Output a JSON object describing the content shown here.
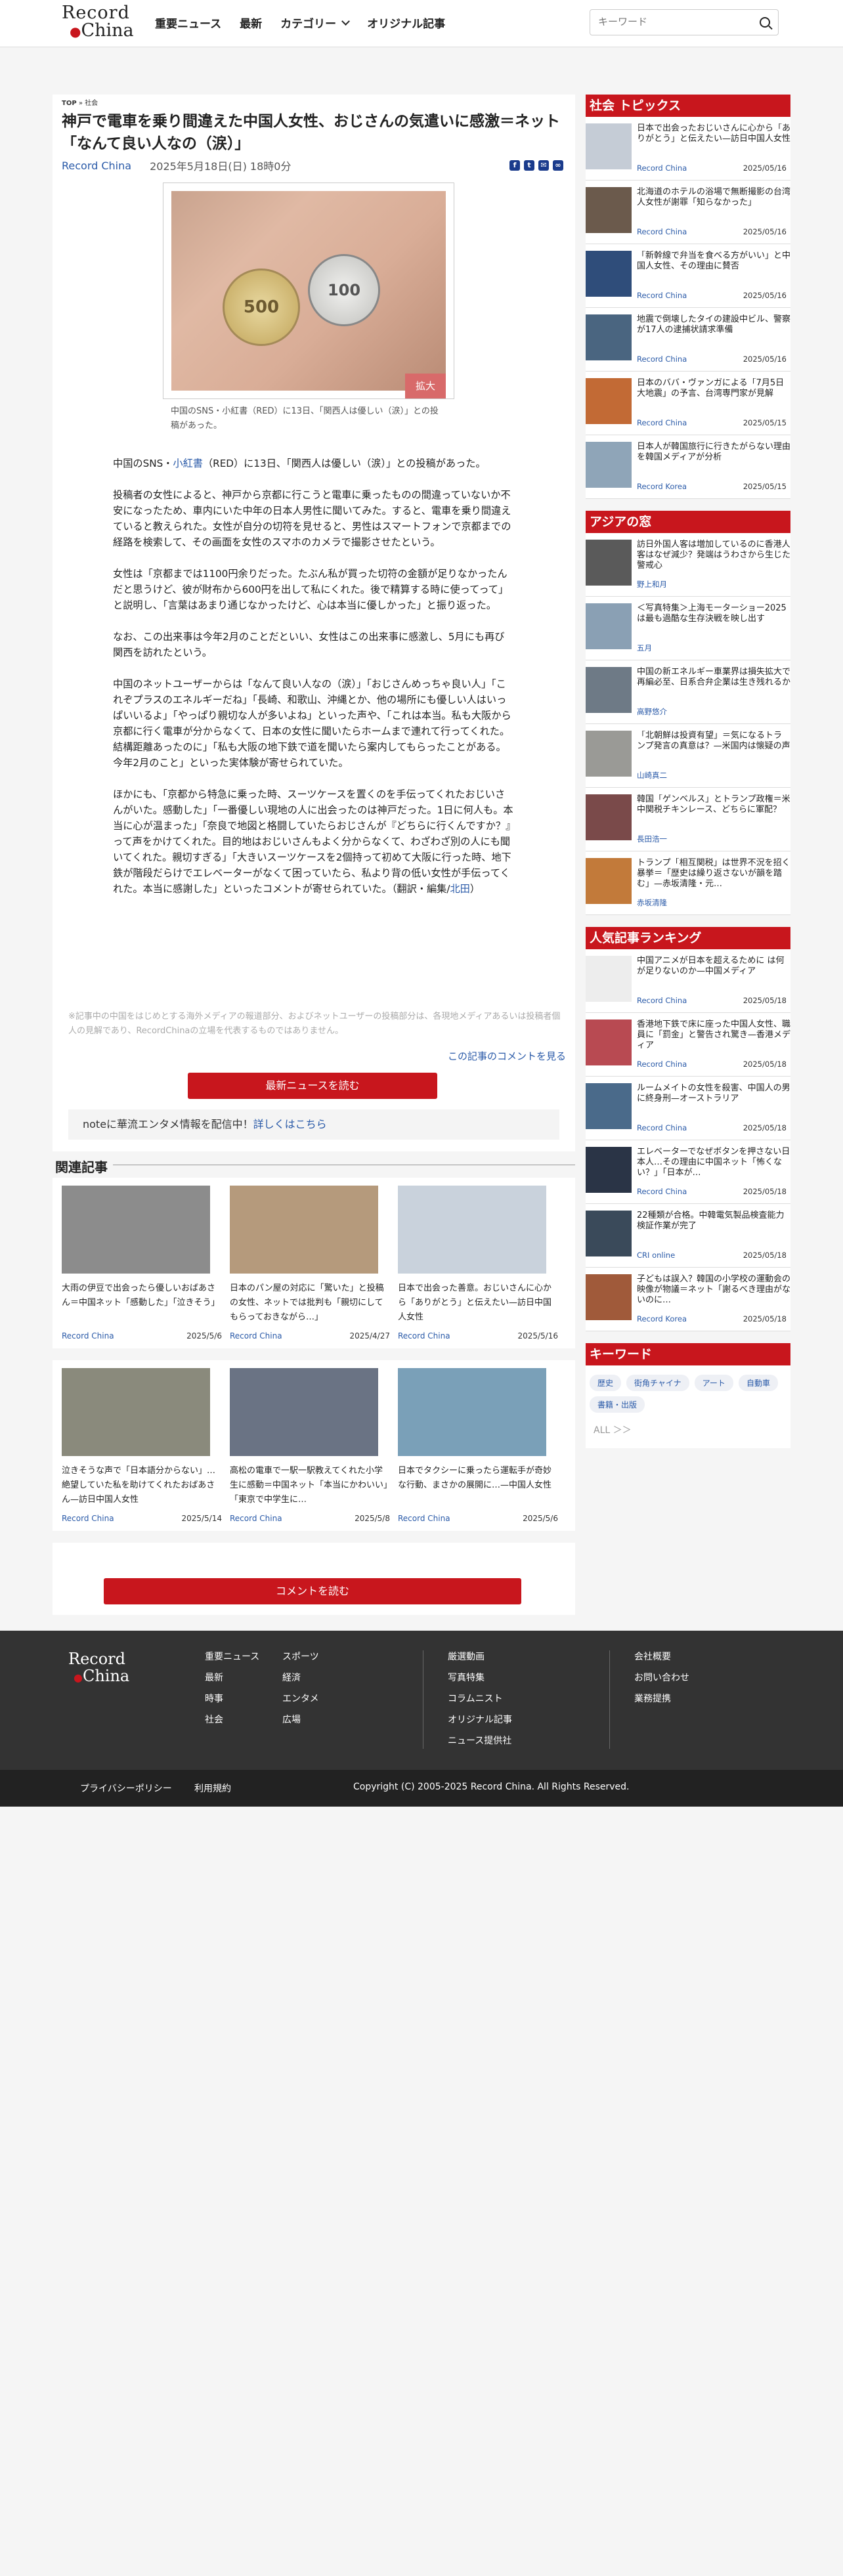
{
  "header": {
    "logo_line1": "Record",
    "logo_line2": "China",
    "nav": [
      "重要ニュース",
      "最新",
      "カテゴリー",
      "オリジナル記事"
    ],
    "search_placeholder": "キーワード"
  },
  "breadcrumb": {
    "top": "TOP",
    "sep": "»",
    "current": "社会"
  },
  "article": {
    "title": "神戸で電車を乗り間違えた中国人女性、おじさんの気遣いに感激＝ネット「なんて良い人なの（涙）」",
    "source": "Record China",
    "date": "2025年5月18日(日) 18時0分",
    "zoom_label": "拡大",
    "coin1": "500",
    "coin2": "100",
    "caption": "中国のSNS・小紅書（RED）に13日、「関西人は優しい（涙）」との投稿があった。",
    "p1_pre": "中国のSNS・",
    "p1_link": "小紅書",
    "p1_post": "（RED）に13日、「関西人は優しい（涙）」との投稿があった。",
    "p2": "投稿者の女性によると、神戸から京都に行こうと電車に乗ったものの間違っていないか不安になったため、車内にいた中年の日本人男性に聞いてみた。すると、電車を乗り間違えていると教えられた。女性が自分の切符を見せると、男性はスマートフォンで京都までの経路を検索して、その画面を女性のスマホのカメラで撮影させたという。",
    "p3": "女性は「京都までは1100円余りだった。たぶん私が買った切符の金額が足りなかったんだと思うけど、彼が財布から600円を出して私にくれた。後で精算する時に使ってって」と説明し、「言葉はあまり通じなかったけど、心は本当に優しかった」と振り返った。",
    "p4": "なお、この出来事は今年2月のことだといい、女性はこの出来事に感激し、5月にも再び関西を訪れたという。",
    "p5": "中国のネットユーザーからは「なんて良い人なの（涙）」「おじさんめっちゃ良い人」「これぞプラスのエネルギーだね」「長崎、和歌山、沖縄とか、他の場所にも優しい人はいっぱいいるよ」「やっぱり親切な人が多いよね」といった声や、「これは本当。私も大阪から京都に行く電車が分からなくて、日本の女性に聞いたらホームまで連れて行ってくれた。結構距離あったのに」「私も大阪の地下鉄で道を聞いたら案内してもらったことがある。今年2月のこと」といった実体験が寄せられていた。",
    "p6_pre": "ほかにも、「京都から特急に乗った時、スーツケースを置くのを手伝ってくれたおじいさんがいた。感動した」「一番優しい現地の人に出会ったのは神戸だった。1日に何人も。本当に心が温まった」「奈良で地図と格闘していたらおじさんが『どちらに行くんですか？』って声をかけてくれた。目的地はおじいさんもよく分からなくて、わざわざ別の人にも聞いてくれた。親切すぎる」「大きいスーツケースを2個持って初めて大阪に行った時、地下鉄が階段だらけでエレベーターがなくて困っていたら、私より背の低い女性が手伝ってくれた。本当に感謝した」といったコメントが寄せられていた。（翻訳・編集/",
    "p6_link": "北田",
    "p6_post": "）"
  },
  "disclaimer": "※記事中の中国をはじめとする海外メディアの報道部分、およびネットユーザーの投稿部分は、各現地メディアあるいは投稿者個人の見解であり、RecordChinaの立場を代表するものではありません。",
  "comments_link": "この記事のコメントを見る",
  "more_news_button": "最新ニュースを読む",
  "note_text": "noteに華流エンタメ情報を配信中！",
  "note_link": "詳しくはこちら",
  "related": {
    "heading": "関連記事",
    "items": [
      {
        "title": "大雨の伊豆で出会ったら優しいおばあさん＝中国ネット「感動した」「泣きそう」",
        "source": "Record China",
        "date": "2025/5/6",
        "color": "#8c8c8c"
      },
      {
        "title": "日本のパン屋の対応に「驚いた」と投稿の女性、ネットでは批判も「親切にしてもらっておきながら…」",
        "source": "Record China",
        "date": "2025/4/27",
        "color": "#b59a7c"
      },
      {
        "title": "日本で出会った善意。おじいさんに心から「ありがとう」と伝えたい—訪日中国人女性",
        "source": "Record China",
        "date": "2025/5/16",
        "color": "#c9d2dc"
      },
      {
        "title": "泣きそうな声で「日本語分からない」…絶望していた私を助けてくれたおばあさん—訪日中国人女性",
        "source": "Record China",
        "date": "2025/5/14",
        "color": "#8a8a7c"
      },
      {
        "title": "高松の電車で一駅一駅教えてくれた小学生に感動＝中国ネット「本当にかわいい」「東京で中学生に…",
        "source": "Record China",
        "date": "2025/5/8",
        "color": "#6a7384"
      },
      {
        "title": "日本でタクシーに乗ったら運転手が奇妙な行動、まさかの展開に…—中国人女性",
        "source": "Record China",
        "date": "2025/5/6",
        "color": "#7aa0b8"
      }
    ]
  },
  "comments_button": "コメントを読む",
  "sidebar": {
    "social_heading": "社会 トピックス",
    "social": [
      {
        "title": "日本で出会ったおじいさんに心から「ありがとう」と伝えたい—訪日中国人女性",
        "source": "Record China",
        "date": "2025/05/16",
        "color": "#c5ccd6"
      },
      {
        "title": "北海道のホテルの浴場で無断撮影の台湾人女性が謝罪「知らなかった」",
        "source": "Record China",
        "date": "2025/05/16",
        "color": "#6b5a4c"
      },
      {
        "title": "「新幹線で弁当を食べる方がいい」と中国人女性、その理由に賛否",
        "source": "Record China",
        "date": "2025/05/16",
        "color": "#2f4d7a"
      },
      {
        "title": "地震で倒壊したタイの建設中ビル、警察が17人の逮捕状請求準備",
        "source": "Record China",
        "date": "2025/05/16",
        "color": "#4a6580"
      },
      {
        "title": "日本のババ・ヴァンガによる「7月5日大地震」の予言、台湾専門家が見解",
        "source": "Record China",
        "date": "2025/05/15",
        "color": "#c26a35"
      },
      {
        "title": "日本人が韓国旅行に行きたがらない理由を韓国メディアが分析",
        "source": "Record Korea",
        "date": "2025/05/15",
        "color": "#8fa5b8"
      }
    ],
    "asia_heading": "アジアの窓",
    "asia": [
      {
        "title": "訪日外国人客は増加しているのに香港人客はなぜ減少？発端はうわさから生じた警戒心",
        "source": "野上和月",
        "color": "#5a5a5a"
      },
      {
        "title": "＜写真特集＞上海モーターショー2025は最も過酷な生存決戦を映し出す",
        "source": "五月",
        "color": "#8aa0b4"
      },
      {
        "title": "中国の新エネルギー車業界は損失拡大で再編必至、日系合弁企業は生き残れるか",
        "source": "高野悠介",
        "color": "#6e7a86"
      },
      {
        "title": "「北朝鮮は投資有望」＝気になるトランプ発言の真意は？—米国内は懐疑の声",
        "source": "山崎真二",
        "color": "#9a9a96"
      },
      {
        "title": "韓国「ゲンベルス」とトランプ政権＝米中関税チキンレース、どちらに軍配？",
        "source": "長田浩一",
        "color": "#7a4a4a"
      },
      {
        "title": "トランプ「相互関税」は世界不況を招く暴挙＝「歴史は繰り返さないが韻を踏む」—赤坂清隆・元…",
        "source": "赤坂清隆",
        "color": "#c27a3a"
      }
    ],
    "ranking_heading": "人気記事ランキング",
    "ranking": [
      {
        "title": "中国アニメが日本を超えるために は何が足りないのか—中国メディア",
        "source": "Record China",
        "date": "2025/05/18",
        "color": "#ededed"
      },
      {
        "title": "香港地下鉄で床に座った中国人女性、職員に「罰金」と警告され驚き—香港メディア",
        "source": "Record China",
        "date": "2025/05/18",
        "color": "#b84a52"
      },
      {
        "title": "ルームメイトの女性を殺害、中国人の男に終身刑—オーストラリア",
        "source": "Record China",
        "date": "2025/05/18",
        "color": "#4a6a8a"
      },
      {
        "title": "エレベーターでなぜボタンを押さない日本人…その理由に中国ネット「怖くない？」「日本が…",
        "source": "Record China",
        "date": "2025/05/18",
        "color": "#2a3446"
      },
      {
        "title": "22種類が合格。中韓電気製品検査能力検証作業が完了",
        "source": "CRI online",
        "date": "2025/05/18",
        "color": "#3a4a5a"
      },
      {
        "title": "子どもは誤入？韓国の小学校の運動会の映像が物議＝ネット「謝るべき理由がないのに…",
        "source": "Record Korea",
        "date": "2025/05/18",
        "color": "#a05a3a"
      }
    ],
    "keyword_heading": "キーワード",
    "keywords": [
      "歴史",
      "街角チャイナ",
      "アート",
      "自動車",
      "書籍・出版"
    ],
    "keywords_all": "ALL ＞＞"
  },
  "footer": {
    "logo_line1": "Record",
    "logo_line2": "China",
    "col1": [
      "重要ニュース",
      "最新",
      "時事",
      "社会"
    ],
    "col2": [
      "スポーツ",
      "経済",
      "エンタメ",
      "広場"
    ],
    "col3": [
      "厳選動画",
      "写真特集",
      "コラムニスト",
      "オリジナル記事",
      "ニュース提供社"
    ],
    "col4": [
      "会社概要",
      "お問い合わせ",
      "業務提携"
    ],
    "privacy": "プライバシーポリシー",
    "terms": "利用規約",
    "copyright": "Copyright (C) 2005-2025 Record China. All Rights Reserved."
  }
}
